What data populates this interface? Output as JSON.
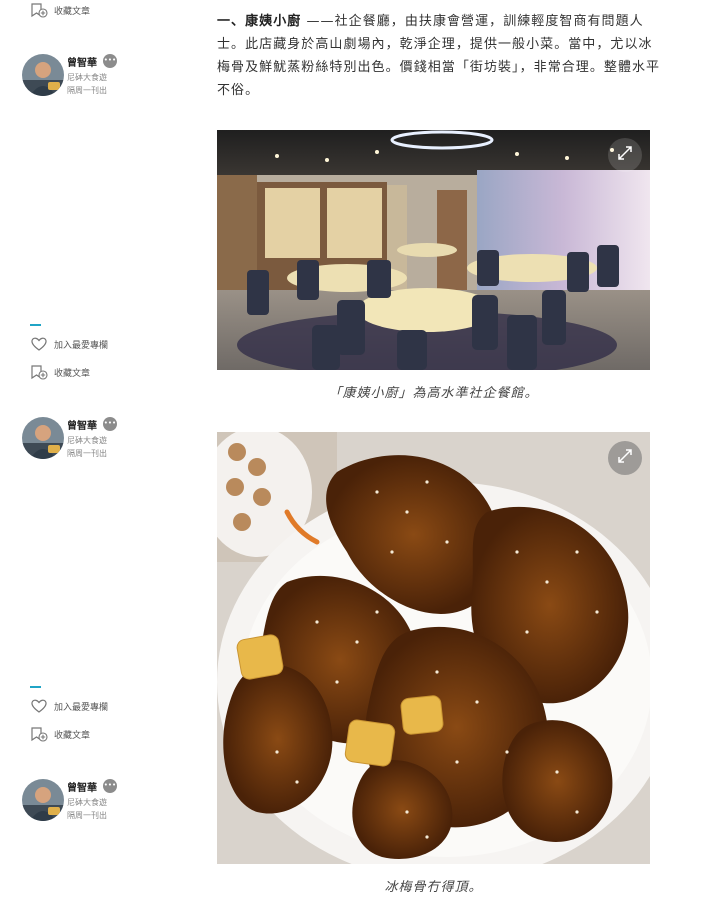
{
  "sidebar": {
    "groups": [
      {
        "save_label": "收藏文章"
      },
      {
        "like_label": "加入最愛專欄",
        "save_label": "收藏文章"
      },
      {
        "like_label": "加入最愛專欄",
        "save_label": "收藏文章"
      }
    ],
    "author": {
      "name": "曾智華",
      "column": "尼砵大食遊",
      "frequency": "隔周一刊出",
      "more": "•••"
    }
  },
  "article": {
    "lead": "一、康姨小廚",
    "body": " ——社企餐廳，由扶康會營運，訓練輕度智商有問題人士。此店藏身於高山劇場內，乾淨企理，提供一般小菜。當中，尤以冰梅骨及鮮魷蒸粉絲特別出色。價錢相當「街坊裝」，非常合理。整體水平不俗。",
    "images": [
      {
        "caption": "「康姨小廚」為高水準社企餐館。",
        "icon": "expand-icon"
      },
      {
        "caption": "冰梅骨冇得頂。",
        "icon": "expand-icon"
      }
    ]
  },
  "colors": {
    "accent": "#20a4c6",
    "text": "#333333",
    "muted": "#888888"
  }
}
